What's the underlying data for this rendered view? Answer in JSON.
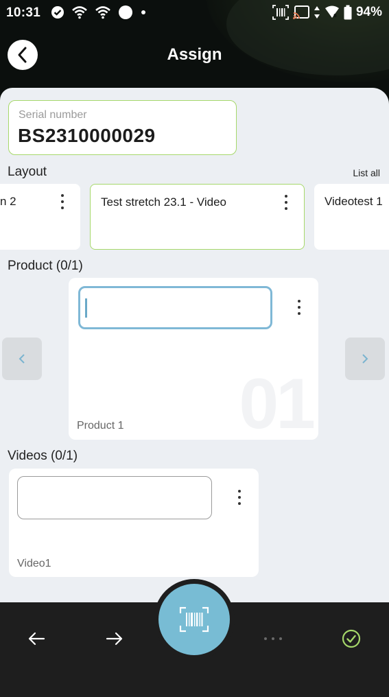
{
  "status_bar": {
    "time": "10:31",
    "battery": "94%",
    "icons_left": [
      "check-circle-icon",
      "wifi-icon",
      "wifi-icon",
      "circle-icon",
      "dot-icon"
    ],
    "icons_right": [
      "barcode-icon",
      "cast-icon",
      "data-arrows-icon",
      "wifi-6-icon",
      "battery-icon"
    ]
  },
  "header": {
    "title": "Assign",
    "back_icon": "chevron-left-icon"
  },
  "serial": {
    "label": "Serial number",
    "value": "BS2310000029"
  },
  "layout": {
    "label": "Layout",
    "list_all": "List all",
    "cards": [
      {
        "name": "n 2"
      },
      {
        "name": "Test stretch 23.1 - Video",
        "selected": true
      },
      {
        "name": "Videotest 1"
      }
    ]
  },
  "product": {
    "label": "Product (0/1)",
    "input_value": "",
    "watermark": "01",
    "caption": "Product 1"
  },
  "videos": {
    "label": "Videos (0/1)",
    "input_value": "",
    "caption": "Video1"
  },
  "bottom_bar": {
    "icons": [
      "arrow-left-icon",
      "arrow-right-icon",
      "barcode-scan-icon",
      "more-horizontal-icon",
      "check-circle-icon"
    ]
  },
  "colors": {
    "accent_green": "#a6d86a",
    "accent_blue": "#78bcd4",
    "background": "#eceff3"
  }
}
